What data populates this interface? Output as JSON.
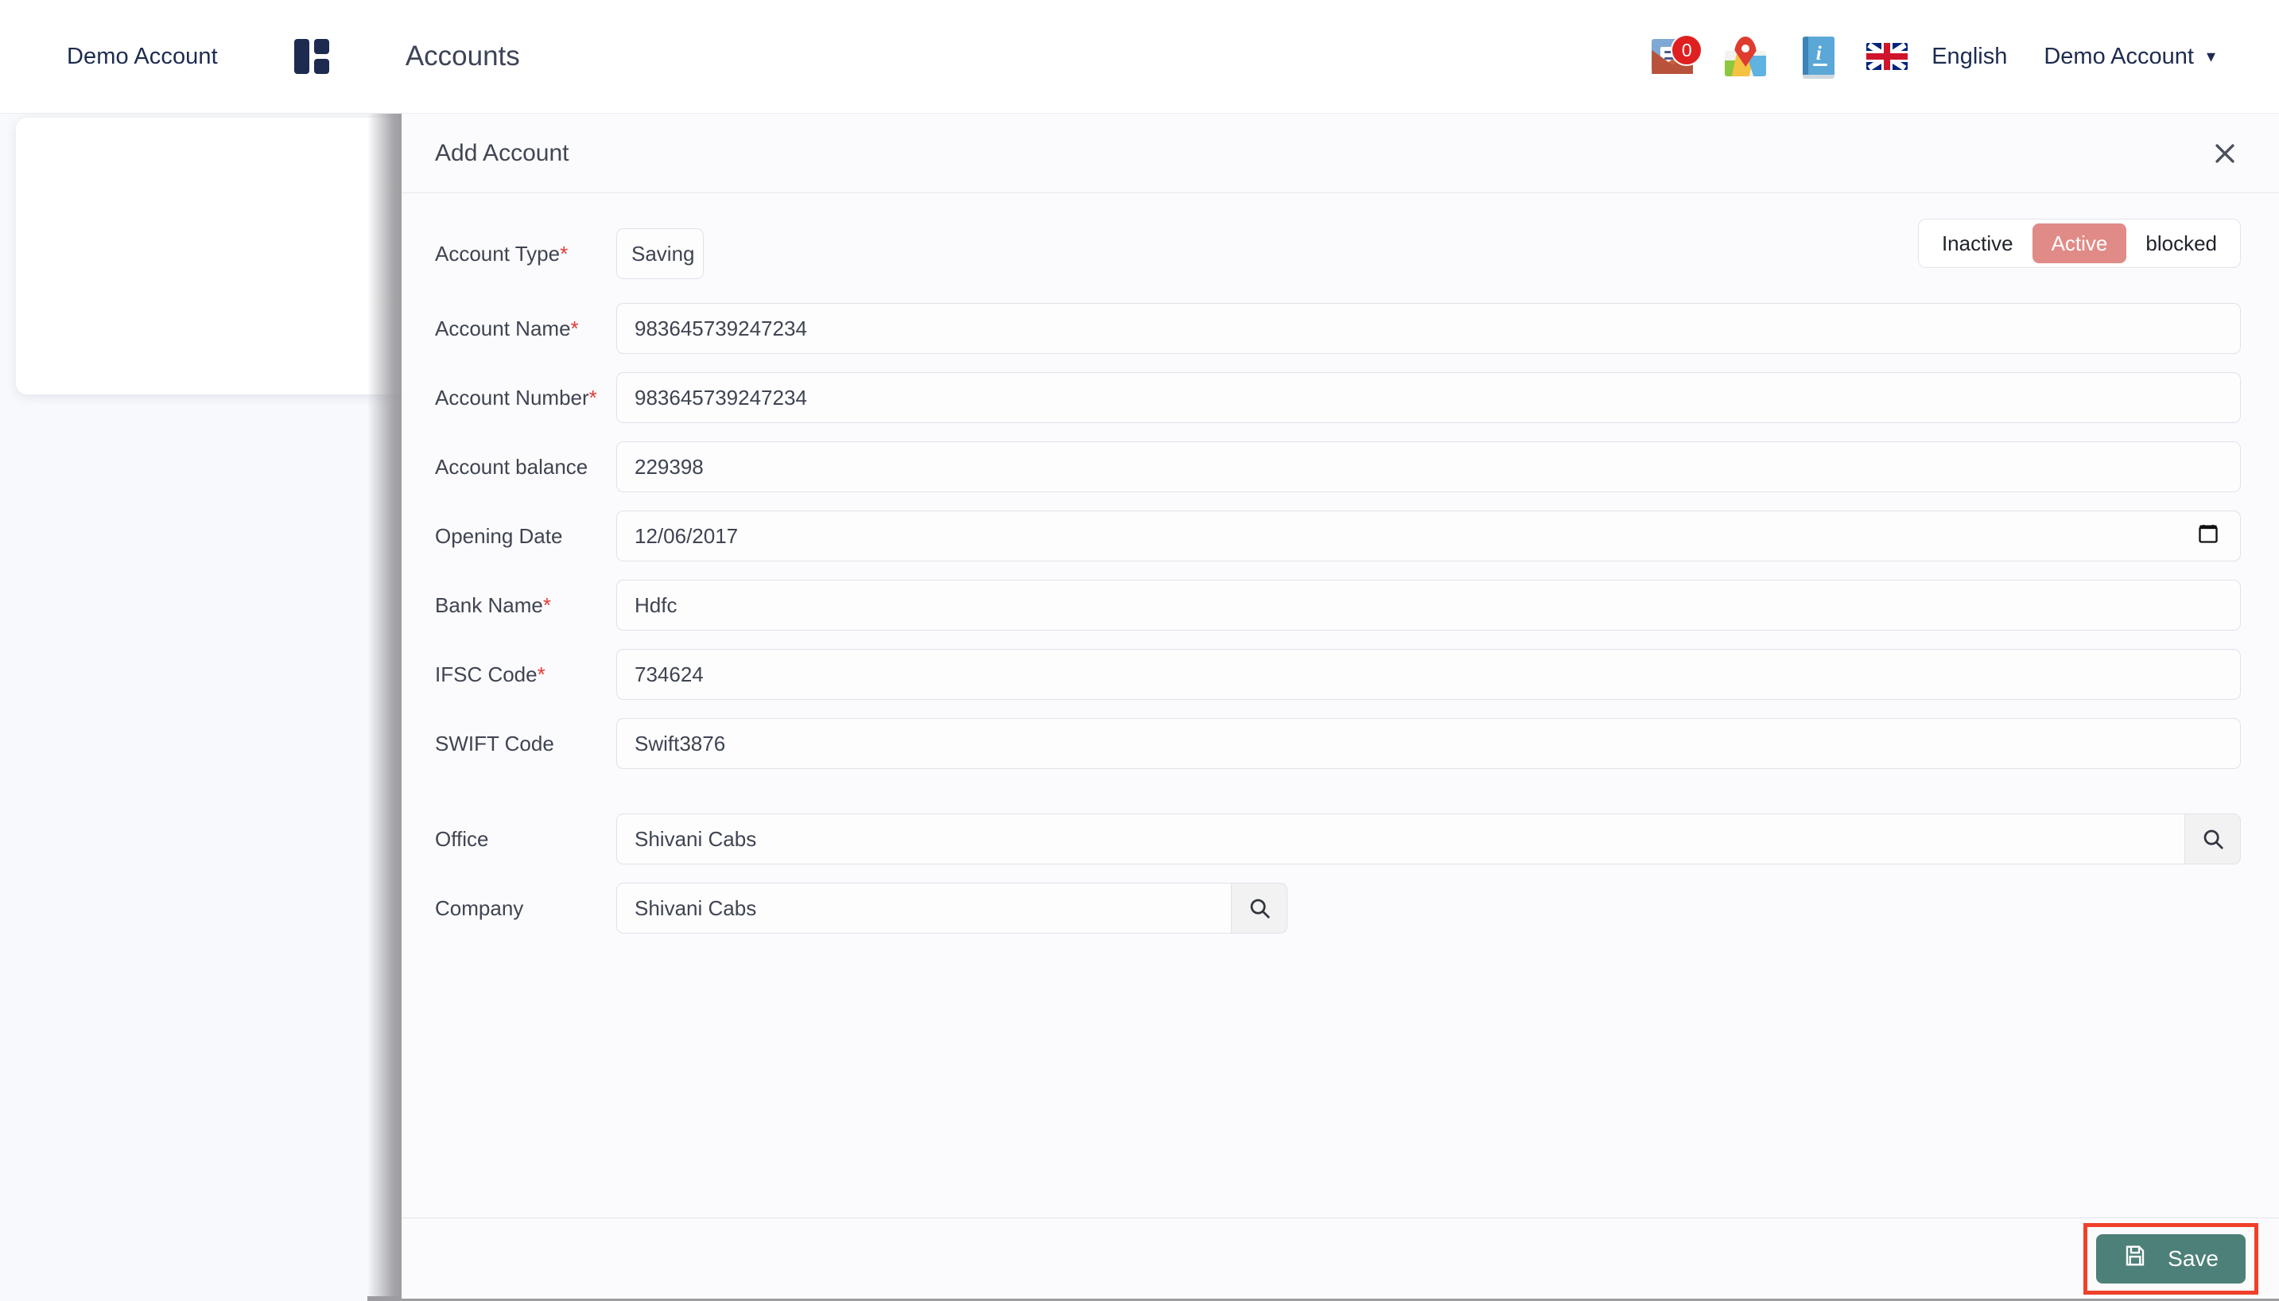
{
  "topnav": {
    "brand": "Demo Account",
    "grid_icon": "grid-icon",
    "page_title": "Accounts",
    "mail": {
      "icon": "mail-icon",
      "badge": "0"
    },
    "map": {
      "icon": "map-icon"
    },
    "info": {
      "icon": "info-book-icon",
      "glyph": "i"
    },
    "language": {
      "flag": "uk-flag-icon",
      "label": "English"
    },
    "account": {
      "label": "Demo Account",
      "chevron": "chevron-down-icon"
    }
  },
  "modal": {
    "title": "Add Account",
    "close_icon": "close-icon",
    "status": {
      "options": [
        "Inactive",
        "Active",
        "blocked"
      ],
      "selected": "Active",
      "active_color": "#e08b87"
    },
    "fields": [
      {
        "label": "Account Type",
        "required": true,
        "value": "Saving",
        "type": "select-small"
      },
      {
        "label": "Account Name",
        "required": true,
        "value": "983645739247234",
        "type": "text"
      },
      {
        "label": "Account Number",
        "required": true,
        "value": "983645739247234",
        "type": "text"
      },
      {
        "label": "Account balance",
        "required": false,
        "value": "229398",
        "type": "text"
      },
      {
        "label": "Opening Date",
        "required": false,
        "value": "12/06/2017",
        "type": "date"
      },
      {
        "label": "Bank Name",
        "required": true,
        "value": "Hdfc",
        "type": "text"
      },
      {
        "label": "IFSC Code",
        "required": true,
        "value": "734624",
        "type": "text"
      },
      {
        "label": "SWIFT Code",
        "required": false,
        "value": "Swift3876",
        "type": "text"
      },
      {
        "label": "Office",
        "required": false,
        "value": "Shivani Cabs",
        "type": "search"
      },
      {
        "label": "Company",
        "required": false,
        "value": "Shivani Cabs",
        "type": "search-narrow"
      }
    ],
    "footer": {
      "save_label": "Save",
      "save_icon": "save-floppy-icon",
      "save_color": "#4d8078",
      "highlight_color": "#f0402a"
    }
  }
}
